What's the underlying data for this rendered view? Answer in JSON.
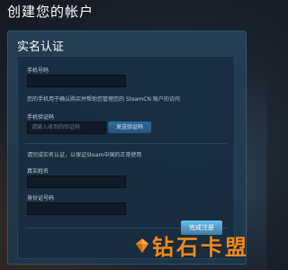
{
  "page": {
    "title": "创建您的帐户"
  },
  "panel": {
    "title": "实名认证"
  },
  "form": {
    "phone_label": "手机号码",
    "phone_value": "",
    "phone_note": "您的手机用于确认购买并帮助您管理您的 SteamCN 账户的访问",
    "code_label": "手机验证码",
    "code_placeholder": "请输入收到的验证码",
    "send_code_button": "发送验证码",
    "realname_note": "请完成实名认证，以保证Steam中国的正常使用",
    "name_label": "真实姓名",
    "name_value": "",
    "id_label": "身份证号码",
    "id_value": "",
    "done_button": "完成注册"
  },
  "watermark": {
    "text": "钻石卡盟",
    "icon": "diamond-logo-icon",
    "color": "#f08a1c"
  }
}
